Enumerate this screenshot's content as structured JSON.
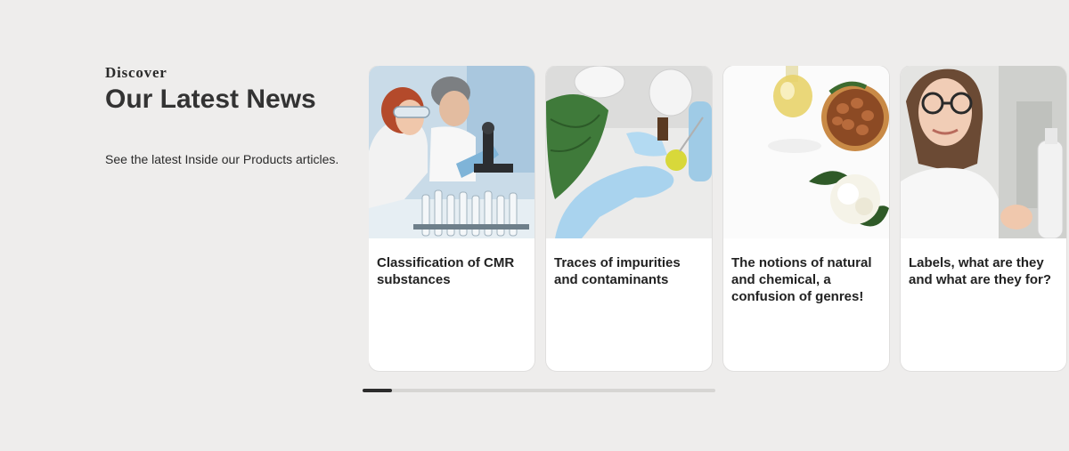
{
  "section": {
    "eyebrow": "Discover",
    "title": "Our Latest News",
    "description": "See the latest Inside our Products articles."
  },
  "cards": [
    {
      "title": "Classification of CMR substances",
      "image": "lab-scientists-microscope-image"
    },
    {
      "title": "Traces of impurities and contaminants",
      "image": "gloved-hand-pipette-image"
    },
    {
      "title": "The notions of natural and chemical, a confusion of genres!",
      "image": "oil-bottle-nuts-flower-image"
    },
    {
      "title": "Labels, what are they and what are they for?",
      "image": "woman-holding-bottle-image"
    }
  ],
  "carousel": {
    "progress_fraction": 0.083
  }
}
